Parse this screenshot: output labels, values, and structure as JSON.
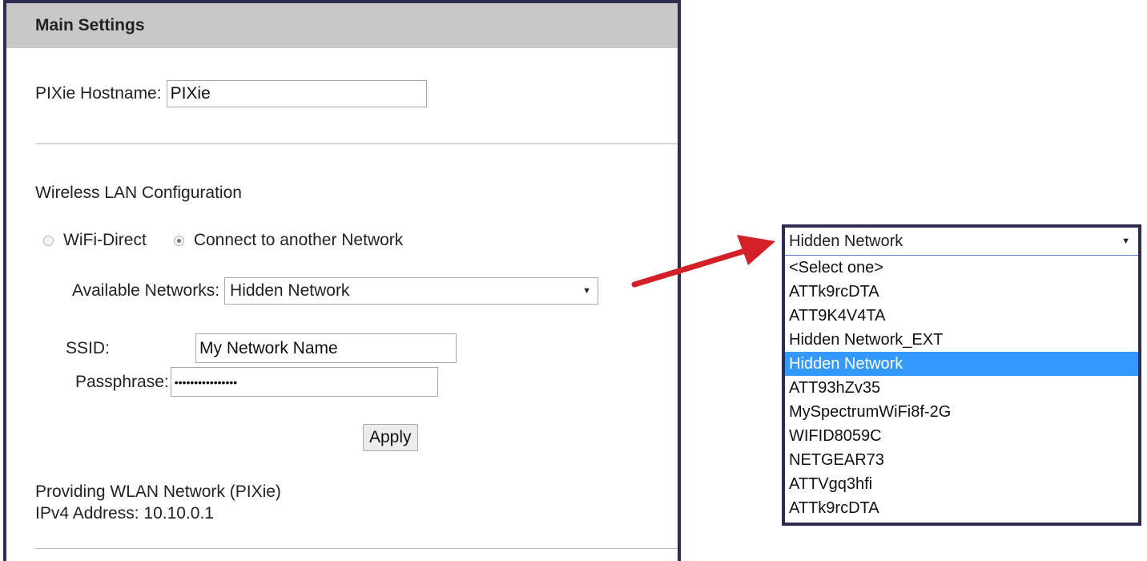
{
  "settings": {
    "header": "Main Settings",
    "hostname_label": "PIXie Hostname:",
    "hostname_value": "PIXie",
    "wlan_title": "Wireless LAN Configuration",
    "mode_options": [
      "WiFi-Direct",
      "Connect to another Network"
    ],
    "selected_mode": "Connect to another Network",
    "available_networks_label": "Available Networks:",
    "available_networks_value": "Hidden Network",
    "ssid_label": "SSID:",
    "ssid_value": "My Network Name",
    "passphrase_label": "Passphrase:",
    "passphrase_value": "••••••••••••••••",
    "apply_label": "Apply",
    "status_line1": "Providing WLAN Network (PIXie)",
    "status_line2": "IPv4 Address: 10.10.0.1"
  },
  "dropdown": {
    "selected": "Hidden Network",
    "options": [
      "<Select one>",
      "ATTk9rcDTA",
      "ATT9K4V4TA",
      "Hidden Network_EXT",
      "Hidden Network",
      "ATT93hZv35",
      "MySpectrumWiFi8f-2G",
      "WIFID8059C",
      "NETGEAR73",
      "ATTVgq3hfi",
      "ATTk9rcDTA"
    ],
    "highlighted_index": 4
  },
  "colors": {
    "frame": "#2e2d4f",
    "header_bg": "#c8c8c8",
    "highlight": "#3399ff",
    "arrow": "#d42027"
  }
}
